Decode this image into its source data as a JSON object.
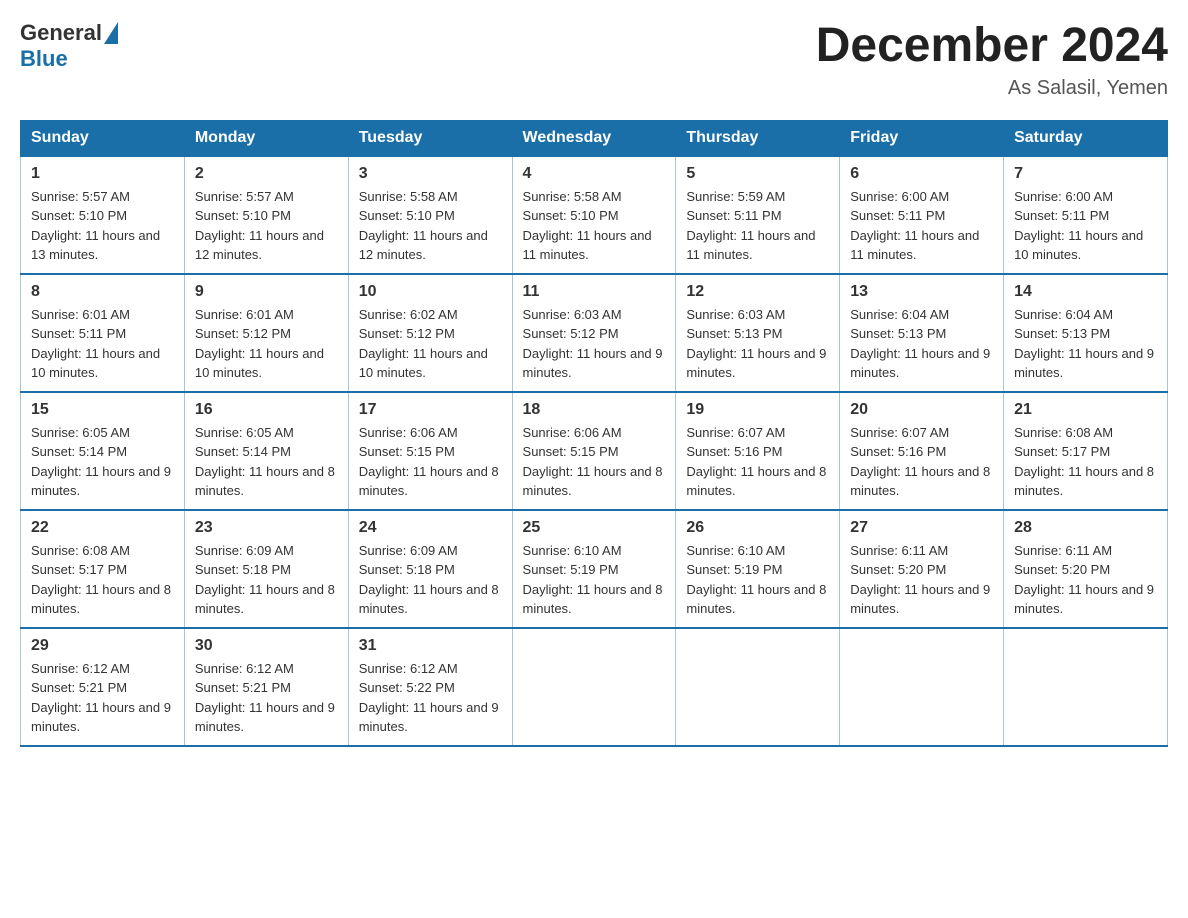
{
  "logo": {
    "text_general": "General",
    "text_blue": "Blue"
  },
  "title": "December 2024",
  "location": "As Salasil, Yemen",
  "days_of_week": [
    "Sunday",
    "Monday",
    "Tuesday",
    "Wednesday",
    "Thursday",
    "Friday",
    "Saturday"
  ],
  "weeks": [
    [
      {
        "day": "1",
        "sunrise": "5:57 AM",
        "sunset": "5:10 PM",
        "daylight": "11 hours and 13 minutes."
      },
      {
        "day": "2",
        "sunrise": "5:57 AM",
        "sunset": "5:10 PM",
        "daylight": "11 hours and 12 minutes."
      },
      {
        "day": "3",
        "sunrise": "5:58 AM",
        "sunset": "5:10 PM",
        "daylight": "11 hours and 12 minutes."
      },
      {
        "day": "4",
        "sunrise": "5:58 AM",
        "sunset": "5:10 PM",
        "daylight": "11 hours and 11 minutes."
      },
      {
        "day": "5",
        "sunrise": "5:59 AM",
        "sunset": "5:11 PM",
        "daylight": "11 hours and 11 minutes."
      },
      {
        "day": "6",
        "sunrise": "6:00 AM",
        "sunset": "5:11 PM",
        "daylight": "11 hours and 11 minutes."
      },
      {
        "day": "7",
        "sunrise": "6:00 AM",
        "sunset": "5:11 PM",
        "daylight": "11 hours and 10 minutes."
      }
    ],
    [
      {
        "day": "8",
        "sunrise": "6:01 AM",
        "sunset": "5:11 PM",
        "daylight": "11 hours and 10 minutes."
      },
      {
        "day": "9",
        "sunrise": "6:01 AM",
        "sunset": "5:12 PM",
        "daylight": "11 hours and 10 minutes."
      },
      {
        "day": "10",
        "sunrise": "6:02 AM",
        "sunset": "5:12 PM",
        "daylight": "11 hours and 10 minutes."
      },
      {
        "day": "11",
        "sunrise": "6:03 AM",
        "sunset": "5:12 PM",
        "daylight": "11 hours and 9 minutes."
      },
      {
        "day": "12",
        "sunrise": "6:03 AM",
        "sunset": "5:13 PM",
        "daylight": "11 hours and 9 minutes."
      },
      {
        "day": "13",
        "sunrise": "6:04 AM",
        "sunset": "5:13 PM",
        "daylight": "11 hours and 9 minutes."
      },
      {
        "day": "14",
        "sunrise": "6:04 AM",
        "sunset": "5:13 PM",
        "daylight": "11 hours and 9 minutes."
      }
    ],
    [
      {
        "day": "15",
        "sunrise": "6:05 AM",
        "sunset": "5:14 PM",
        "daylight": "11 hours and 9 minutes."
      },
      {
        "day": "16",
        "sunrise": "6:05 AM",
        "sunset": "5:14 PM",
        "daylight": "11 hours and 8 minutes."
      },
      {
        "day": "17",
        "sunrise": "6:06 AM",
        "sunset": "5:15 PM",
        "daylight": "11 hours and 8 minutes."
      },
      {
        "day": "18",
        "sunrise": "6:06 AM",
        "sunset": "5:15 PM",
        "daylight": "11 hours and 8 minutes."
      },
      {
        "day": "19",
        "sunrise": "6:07 AM",
        "sunset": "5:16 PM",
        "daylight": "11 hours and 8 minutes."
      },
      {
        "day": "20",
        "sunrise": "6:07 AM",
        "sunset": "5:16 PM",
        "daylight": "11 hours and 8 minutes."
      },
      {
        "day": "21",
        "sunrise": "6:08 AM",
        "sunset": "5:17 PM",
        "daylight": "11 hours and 8 minutes."
      }
    ],
    [
      {
        "day": "22",
        "sunrise": "6:08 AM",
        "sunset": "5:17 PM",
        "daylight": "11 hours and 8 minutes."
      },
      {
        "day": "23",
        "sunrise": "6:09 AM",
        "sunset": "5:18 PM",
        "daylight": "11 hours and 8 minutes."
      },
      {
        "day": "24",
        "sunrise": "6:09 AM",
        "sunset": "5:18 PM",
        "daylight": "11 hours and 8 minutes."
      },
      {
        "day": "25",
        "sunrise": "6:10 AM",
        "sunset": "5:19 PM",
        "daylight": "11 hours and 8 minutes."
      },
      {
        "day": "26",
        "sunrise": "6:10 AM",
        "sunset": "5:19 PM",
        "daylight": "11 hours and 8 minutes."
      },
      {
        "day": "27",
        "sunrise": "6:11 AM",
        "sunset": "5:20 PM",
        "daylight": "11 hours and 9 minutes."
      },
      {
        "day": "28",
        "sunrise": "6:11 AM",
        "sunset": "5:20 PM",
        "daylight": "11 hours and 9 minutes."
      }
    ],
    [
      {
        "day": "29",
        "sunrise": "6:12 AM",
        "sunset": "5:21 PM",
        "daylight": "11 hours and 9 minutes."
      },
      {
        "day": "30",
        "sunrise": "6:12 AM",
        "sunset": "5:21 PM",
        "daylight": "11 hours and 9 minutes."
      },
      {
        "day": "31",
        "sunrise": "6:12 AM",
        "sunset": "5:22 PM",
        "daylight": "11 hours and 9 minutes."
      },
      null,
      null,
      null,
      null
    ]
  ]
}
